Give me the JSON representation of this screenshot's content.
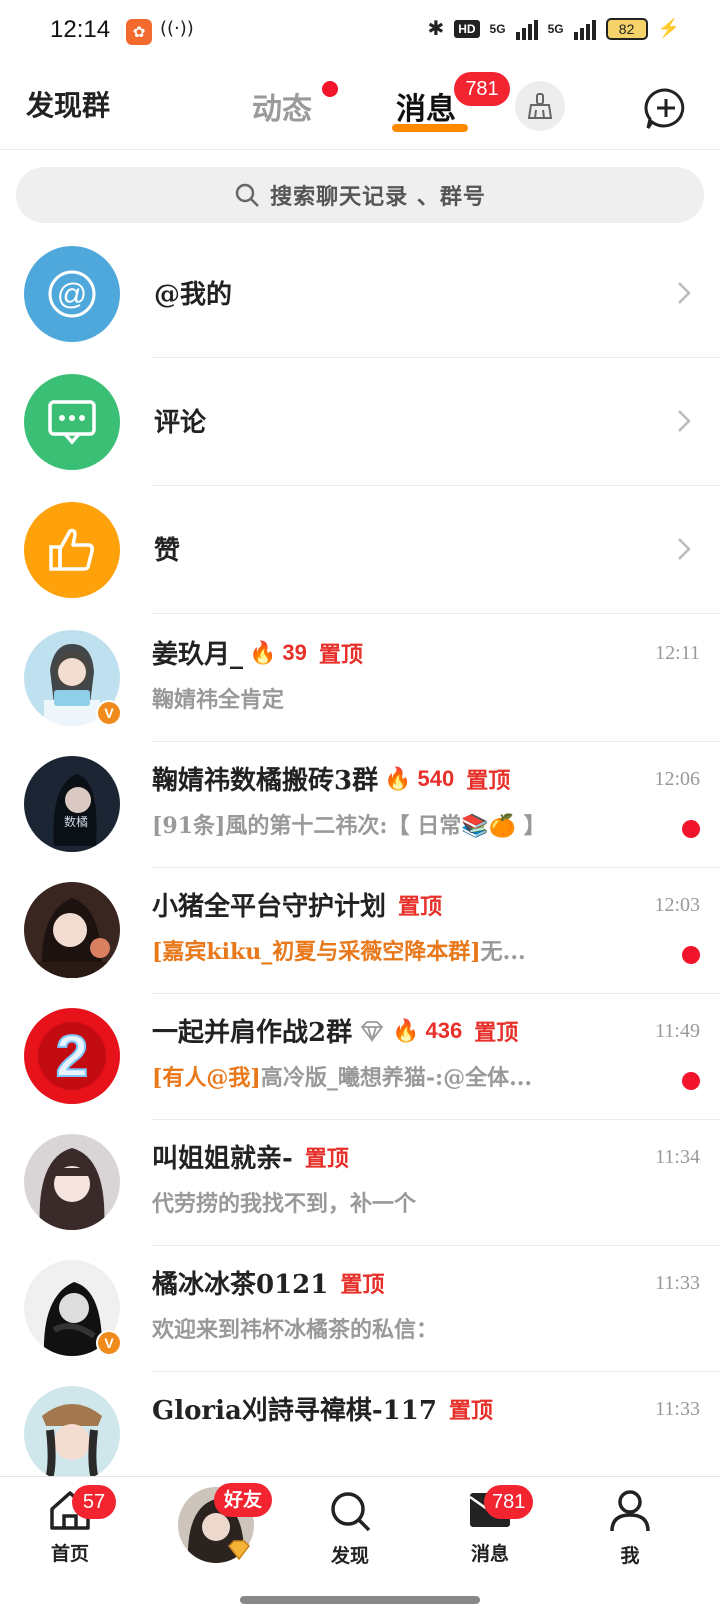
{
  "status_bar": {
    "time": "12:14",
    "signal_1": "5G",
    "signal_2": "5G",
    "hd_label": "HD",
    "battery": "82"
  },
  "top_nav": {
    "discover_label": "发现群",
    "tab_dynamic": "动态",
    "tab_messages": "消息",
    "messages_badge": "781",
    "clean_icon": "broom-icon",
    "compose_icon": "new-chat-icon"
  },
  "search": {
    "placeholder": "搜索聊天记录 、群号"
  },
  "system_items": [
    {
      "label": "@我的",
      "icon": "at-icon",
      "color": "#4fa8db"
    },
    {
      "label": "评论",
      "icon": "comment-icon",
      "color": "#3bbf74"
    },
    {
      "label": "赞",
      "icon": "thumbs-up-icon",
      "color": "#ffa10a"
    }
  ],
  "chats": [
    {
      "title": "姜玖月_",
      "fire": "39",
      "pinned": "置顶",
      "time": "12:11",
      "preview_tag": "",
      "preview": "鞠婧祎全肯定",
      "unread": false,
      "verified": true
    },
    {
      "title": "鞠婧祎数橘搬砖3群",
      "fire": "540",
      "pinned": "置顶",
      "time": "12:06",
      "preview_tag": "",
      "preview": "[91条]風的第十二祎次:【 日常📚🍊 】",
      "unread": true,
      "verified": false
    },
    {
      "title": "小猪全平台守护计划",
      "fire": "",
      "pinned": "置顶",
      "time": "12:03",
      "preview_tag": "[嘉宾kiku_初夏与采薇空降本群]",
      "preview": "无...",
      "unread": true,
      "verified": false
    },
    {
      "title": "一起并肩作战2群",
      "fire": "436",
      "pinned": "置顶",
      "time": "11:49",
      "preview_tag": "[有人@我]",
      "preview": "高冷版_曦想养猫-:@全体...",
      "unread": true,
      "verified": false
    },
    {
      "title": "叫姐姐就亲-",
      "fire": "",
      "pinned": "置顶",
      "time": "11:34",
      "preview_tag": "",
      "preview": "代劳捞的我找不到，补一个",
      "unread": false,
      "verified": false
    },
    {
      "title": "橘冰冰茶0121",
      "fire": "",
      "pinned": "置顶",
      "time": "11:33",
      "preview_tag": "",
      "preview": "欢迎来到祎杯冰橘茶的私信：",
      "unread": false,
      "verified": true
    },
    {
      "title": "Gloria刈詩寻禕棋-117",
      "fire": "",
      "pinned": "置顶",
      "time": "11:33",
      "preview_tag": "",
      "preview": "",
      "unread": false,
      "verified": false
    }
  ],
  "bottom_nav": {
    "home_label": "首页",
    "home_badge": "57",
    "friends_badge": "好友",
    "discover_label": "发现",
    "messages_label": "消息",
    "messages_badge": "781",
    "me_label": "我"
  },
  "colors": {
    "accent": "#ff8a00",
    "badge_red": "#f2242f",
    "pin_red": "#e8302a",
    "tag_orange": "#e8781a"
  }
}
